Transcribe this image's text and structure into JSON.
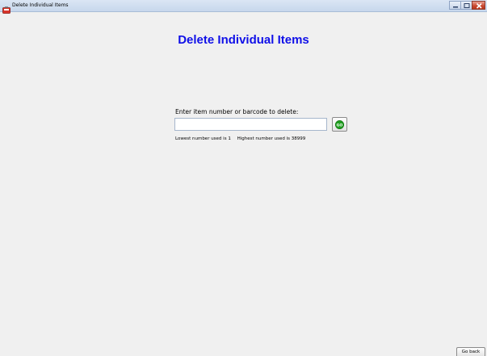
{
  "window": {
    "title": "Delete Individual Items",
    "controls": [
      "minimize-icon",
      "maximize-icon",
      "close-icon"
    ]
  },
  "main": {
    "heading": "Delete Individual Items",
    "prompt_label": "Enter item number or barcode to delete:",
    "item_input": {
      "value": "",
      "placeholder": ""
    },
    "go_button_label": "GO",
    "lowest_text": "Lowest number used is 1",
    "highest_text": "Highest number used is 38999"
  },
  "footer": {
    "go_back_label": "Go back"
  },
  "colors": {
    "heading": "#1010e8",
    "go_icon": "#1e9e1e",
    "background": "#f0f0f0"
  }
}
